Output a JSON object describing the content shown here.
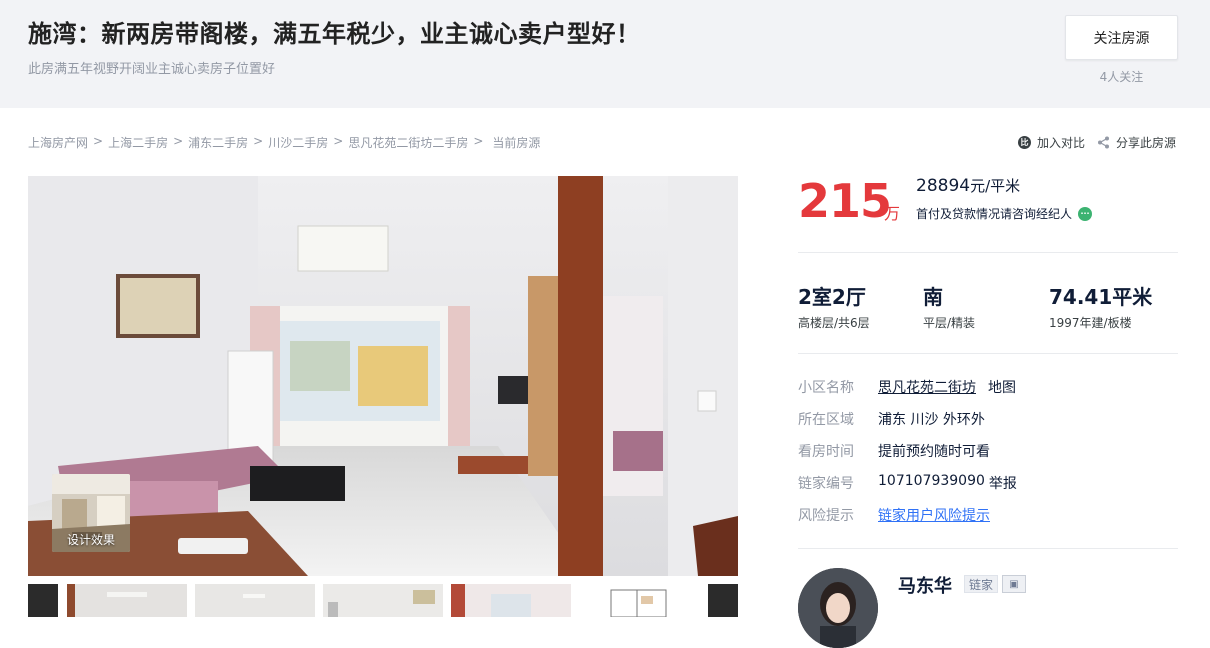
{
  "header": {
    "title": "施湾：新两房带阁楼，满五年税少，业主诚心卖户型好！",
    "subtitle": "此房满五年视野开阔业主诚心卖房子位置好",
    "follow_button": "关注房源",
    "follow_count": "4人关注"
  },
  "breadcrumb": {
    "items": [
      "上海房产网",
      "上海二手房",
      "浦东二手房",
      "川沙二手房",
      "思凡花苑二街坊二手房"
    ],
    "separator": ">",
    "current": "当前房源"
  },
  "tools": {
    "compare": "加入对比",
    "share": "分享此房源"
  },
  "gallery": {
    "design_label": "设计效果"
  },
  "price": {
    "total": "215",
    "total_unit": "万",
    "unit_price_value": "28894",
    "unit_price_unit": "元/平米",
    "payment_note": "首付及贷款情况请咨询经纪人"
  },
  "specs": [
    {
      "main": "2室2厅",
      "sub": "高楼层/共6层"
    },
    {
      "main": "南",
      "sub": "平层/精装"
    },
    {
      "main": "74.41平米",
      "sub": "1997年建/板楼"
    }
  ],
  "info": {
    "community": {
      "label": "小区名称",
      "value": "思凡花苑二街坊",
      "extra": "地图"
    },
    "area": {
      "label": "所在区域",
      "value": "浦东 川沙 外环外"
    },
    "visit": {
      "label": "看房时间",
      "value": "提前预约随时可看"
    },
    "code": {
      "label": "链家编号",
      "value": "107107939090",
      "extra": "举报"
    },
    "risk": {
      "label": "风险提示",
      "value": "链家用户风险提示"
    }
  },
  "agent": {
    "name": "马东华",
    "tag": "链家"
  },
  "colors": {
    "price_red": "#e4393c",
    "link_blue": "#3072f6",
    "top_band": "#f2f3f6",
    "chat_green": "#3cb371"
  }
}
